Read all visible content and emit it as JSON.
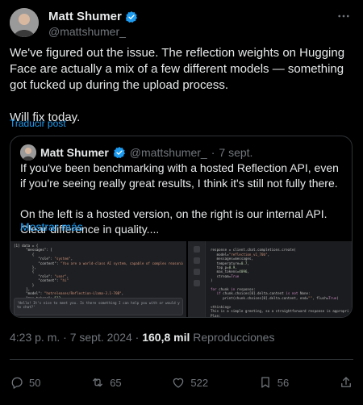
{
  "author": {
    "name": "Matt Shumer",
    "handle": "@mattshumer_"
  },
  "tweet": {
    "text": "We've figured out the issue. The reflection weights on Hugging Face are actually a mix of a few different models — something got fucked up during the upload process.\n\nWill fix today.",
    "translate_label": "Traducir post",
    "time": "4:23 p. m.",
    "date": "7 sept. 2024",
    "views_count": "160,8 mil",
    "views_label": "Reproducciones"
  },
  "quoted": {
    "name": "Matt Shumer",
    "handle": "@mattshumer_",
    "date": "7 sept.",
    "text": "If you've been benchmarking with a hosted Reflection API, even if you're seeing really great results, I think it's still not fully there.\n\nOn the left is a hosted version, on the right is our internal API.  Clear difference in quality....",
    "show_more": "Mostrar más"
  },
  "actions": {
    "replies": "50",
    "reposts": "65",
    "likes": "522",
    "bookmarks": "56"
  },
  "colors": {
    "background": "#000000",
    "accent": "#1d9bf0",
    "muted": "#71767b",
    "text": "#e7e9ea"
  }
}
